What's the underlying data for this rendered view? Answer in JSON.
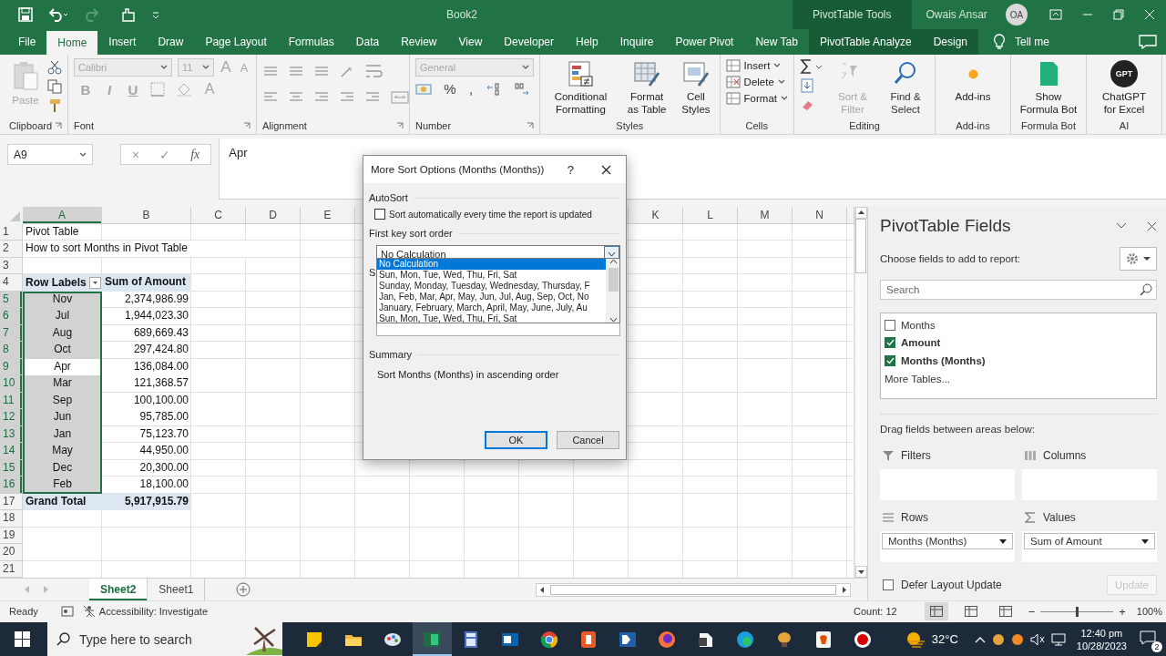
{
  "title_bar": {
    "document": "Book2",
    "context_tab": "PivotTable Tools",
    "user": "Owais Ansar",
    "avatar": "OA"
  },
  "ribbon_tabs": [
    {
      "label": "File",
      "selected": false,
      "kind": "normal"
    },
    {
      "label": "Home",
      "selected": true,
      "kind": "normal"
    },
    {
      "label": "Insert",
      "selected": false,
      "kind": "normal"
    },
    {
      "label": "Draw",
      "selected": false,
      "kind": "normal"
    },
    {
      "label": "Page Layout",
      "selected": false,
      "kind": "normal"
    },
    {
      "label": "Formulas",
      "selected": false,
      "kind": "normal"
    },
    {
      "label": "Data",
      "selected": false,
      "kind": "normal"
    },
    {
      "label": "Review",
      "selected": false,
      "kind": "normal"
    },
    {
      "label": "View",
      "selected": false,
      "kind": "normal"
    },
    {
      "label": "Developer",
      "selected": false,
      "kind": "normal"
    },
    {
      "label": "Help",
      "selected": false,
      "kind": "normal"
    },
    {
      "label": "Inquire",
      "selected": false,
      "kind": "normal"
    },
    {
      "label": "Power Pivot",
      "selected": false,
      "kind": "normal"
    },
    {
      "label": "New Tab",
      "selected": false,
      "kind": "normal"
    },
    {
      "label": "PivotTable Analyze",
      "selected": false,
      "kind": "context"
    },
    {
      "label": "Design",
      "selected": false,
      "kind": "context"
    }
  ],
  "tell_me": "Tell me",
  "ribbon_groups": [
    {
      "kind": "clipboard",
      "name": "Clipboard",
      "paste": "Paste",
      "disabled": true
    },
    {
      "kind": "font",
      "name": "Font",
      "font": "Calibri",
      "size": "11",
      "size_buttons": [
        "A",
        "A"
      ],
      "format_buttons": [
        "B",
        "I",
        "U"
      ],
      "color_button": "A",
      "disabled": true
    },
    {
      "kind": "alignment",
      "name": "Alignment"
    },
    {
      "kind": "number",
      "name": "Number",
      "format": "General",
      "symbols": [
        "%",
        ","
      ],
      "disabled": true
    },
    {
      "kind": "large",
      "name": "Styles",
      "buttons": [
        {
          "label": "Conditional Formatting"
        },
        {
          "label": "Format as Table"
        },
        {
          "label": "Cell Styles"
        }
      ]
    },
    {
      "kind": "cells",
      "name": "Cells",
      "buttons": [
        "Insert",
        "Delete",
        "Format"
      ]
    },
    {
      "kind": "editing",
      "name": "Editing",
      "buttons": [
        {
          "label": "Sort & Filter",
          "disabled": true
        },
        {
          "label": "Find & Select",
          "disabled": false
        }
      ]
    },
    {
      "kind": "large",
      "name": "Add-ins",
      "buttons": [
        {
          "label": "Add-ins"
        }
      ]
    },
    {
      "kind": "large",
      "name": "Formula Bot",
      "buttons": [
        {
          "label": "Show Formula Bot"
        }
      ]
    },
    {
      "kind": "large",
      "name": "AI",
      "buttons": [
        {
          "label": "ChatGPT for Excel",
          "badge": "GPT"
        }
      ]
    }
  ],
  "formula_bar": {
    "name_box": "A9",
    "cancel": "×",
    "enter": "✓",
    "function": "fx",
    "content": "Apr"
  },
  "sheet": {
    "columns_left": [
      {
        "label": "A",
        "selected": true
      },
      {
        "label": "B",
        "selected": false
      },
      {
        "label": "C",
        "selected": false
      },
      {
        "label": "D",
        "selected": false
      },
      {
        "label": "E",
        "selected": false
      }
    ],
    "columns_right": [
      {
        "label": "K",
        "selected": false
      },
      {
        "label": "L",
        "selected": false
      },
      {
        "label": "M",
        "selected": false
      },
      {
        "label": "N",
        "selected": false
      }
    ],
    "row_numbers": [
      {
        "label": "1",
        "selected": false
      },
      {
        "label": "2",
        "selected": false
      },
      {
        "label": "3",
        "selected": false
      },
      {
        "label": "4",
        "selected": false
      },
      {
        "label": "5",
        "selected": true
      },
      {
        "label": "6",
        "selected": true
      },
      {
        "label": "7",
        "selected": true
      },
      {
        "label": "8",
        "selected": true
      },
      {
        "label": "9",
        "selected": true
      },
      {
        "label": "10",
        "selected": true
      },
      {
        "label": "11",
        "selected": true
      },
      {
        "label": "12",
        "selected": true
      },
      {
        "label": "13",
        "selected": true
      },
      {
        "label": "14",
        "selected": true
      },
      {
        "label": "15",
        "selected": true
      },
      {
        "label": "16",
        "selected": true
      },
      {
        "label": "17",
        "selected": false
      },
      {
        "label": "18",
        "selected": false
      },
      {
        "label": "19",
        "selected": false
      },
      {
        "label": "20",
        "selected": false
      },
      {
        "label": "21",
        "selected": false
      }
    ],
    "notes": [
      "Pivot Table",
      "How to sort Months in Pivot Table"
    ],
    "pivot_header": [
      "Row Labels",
      "Sum of Amount"
    ],
    "pivot_rows": [
      {
        "label": "Nov",
        "value": "2,374,986.99",
        "selected": true,
        "active": false
      },
      {
        "label": "Jul",
        "value": "1,944,023.30",
        "selected": true,
        "active": false
      },
      {
        "label": "Aug",
        "value": "689,669.43",
        "selected": true,
        "active": false
      },
      {
        "label": "Oct",
        "value": "297,424.80",
        "selected": true,
        "active": false
      },
      {
        "label": "Apr",
        "value": "136,084.00",
        "selected": true,
        "active": true
      },
      {
        "label": "Mar",
        "value": "121,368.57",
        "selected": true,
        "active": false
      },
      {
        "label": "Sep",
        "value": "100,100.00",
        "selected": true,
        "active": false
      },
      {
        "label": "Jun",
        "value": "95,785.00",
        "selected": true,
        "active": false
      },
      {
        "label": "Jan",
        "value": "75,123.70",
        "selected": true,
        "active": false
      },
      {
        "label": "May",
        "value": "44,950.00",
        "selected": true,
        "active": false
      },
      {
        "label": "Dec",
        "value": "20,300.00",
        "selected": true,
        "active": false
      },
      {
        "label": "Feb",
        "value": "18,100.00",
        "selected": true,
        "active": false
      }
    ],
    "pivot_total": {
      "label": "Grand Total",
      "value": "5,917,915.79"
    },
    "sheet_tabs": [
      {
        "label": "Sheet2",
        "selected": true
      },
      {
        "label": "Sheet1",
        "selected": false
      }
    ]
  },
  "dialog": {
    "title": "More Sort Options (Months (Months))",
    "help": "?",
    "autosort_label": "AutoSort",
    "autosort_option": {
      "label": "Sort automatically every time the report is updated",
      "checked": false
    },
    "sort_order_label": "First key sort order",
    "sort_order": {
      "value": "No Calculation",
      "expanded": true,
      "options": [
        {
          "label": "No Calculation",
          "selected": true
        },
        {
          "label": "Sun, Mon, Tue, Wed, Thu, Fri, Sat",
          "selected": false
        },
        {
          "label": "Sunday, Monday, Tuesday, Wednesday, Thursday, F",
          "selected": false
        },
        {
          "label": "Jan, Feb, Mar, Apr, May, Jun, Jul, Aug, Sep, Oct, No",
          "selected": false
        },
        {
          "label": "January, February, March, April, May, June, July, Au",
          "selected": false
        },
        {
          "label": "Sun, Mon, Tue, Wed, Thu, Fri, Sat",
          "selected": false
        }
      ]
    },
    "covered_label": "S",
    "summary_label": "Summary",
    "summary": "Sort Months (Months) in ascending order",
    "buttons": [
      {
        "label": "OK",
        "default": true
      },
      {
        "label": "Cancel",
        "default": false
      }
    ]
  },
  "pane": {
    "title": "PivotTable Fields",
    "subtitle": "Choose fields to add to report:",
    "search_placeholder": "Search",
    "fields": [
      {
        "label": "Months",
        "checked": false
      },
      {
        "label": "Amount",
        "checked": true
      },
      {
        "label": "Months (Months)",
        "checked": true
      }
    ],
    "more_tables": "More Tables...",
    "areas_hint": "Drag fields between areas below:",
    "areas": [
      {
        "kind": "filters",
        "label": "Filters"
      },
      {
        "kind": "columns",
        "label": "Columns"
      },
      {
        "kind": "rows",
        "label": "Rows",
        "items": [
          "Months (Months)"
        ]
      },
      {
        "kind": "values",
        "label": "Values",
        "items": [
          "Sum of Amount"
        ]
      }
    ],
    "defer": {
      "label": "Defer Layout Update",
      "checked": false
    },
    "update": {
      "label": "Update",
      "disabled": true
    }
  },
  "status_bar": {
    "mode": "Ready",
    "accessibility": "Accessibility: Investigate",
    "count": "Count: 12",
    "views": [
      {
        "selected": true
      },
      {
        "selected": false
      },
      {
        "selected": false
      }
    ],
    "zoom_out": "−",
    "zoom_slider": {
      "level": 0.5
    },
    "zoom_in": "+",
    "zoom": "100%"
  },
  "taskbar": {
    "search_placeholder": "Type here to search",
    "apps": [
      {
        "active": false
      },
      {
        "active": false
      },
      {
        "active": false
      },
      {
        "active": true
      },
      {
        "active": false
      },
      {
        "active": false
      },
      {
        "active": false
      },
      {
        "active": false
      },
      {
        "active": false
      },
      {
        "active": false
      },
      {
        "active": false
      },
      {
        "active": false
      },
      {
        "active": false
      },
      {
        "active": false
      },
      {
        "active": false
      }
    ],
    "weather": "32°C",
    "time": "12:40 pm",
    "date": "10/28/2023",
    "notifications": "2"
  }
}
